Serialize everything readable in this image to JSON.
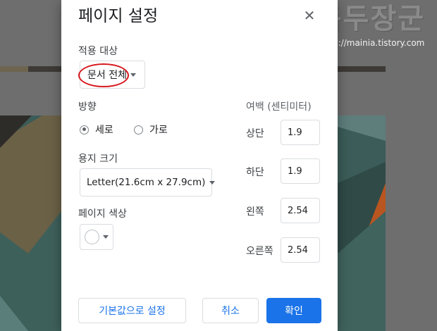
{
  "watermark": {
    "title": "독두장군",
    "url": "http://mainia.tistory.com"
  },
  "dialog": {
    "title": "페이지 설정",
    "apply_to": {
      "label": "적용 대상",
      "value": "문서 전체"
    },
    "orientation": {
      "label": "방향",
      "options": [
        {
          "label": "세로",
          "selected": true
        },
        {
          "label": "가로",
          "selected": false
        }
      ]
    },
    "paper_size": {
      "label": "용지 크기",
      "value": "Letter(21.6cm x 27.9cm)"
    },
    "page_color": {
      "label": "페이지 색상",
      "value": "#ffffff"
    },
    "margins": {
      "label": "여백 (센티미터)",
      "fields": [
        {
          "label": "상단",
          "value": "1.9"
        },
        {
          "label": "하단",
          "value": "1.9"
        },
        {
          "label": "왼쪽",
          "value": "2.54"
        },
        {
          "label": "오른쪽",
          "value": "2.54"
        }
      ]
    },
    "buttons": {
      "set_default": "기본값으로 설정",
      "cancel": "취소",
      "ok": "확인"
    }
  },
  "colors": {
    "accent": "#1a73e8",
    "annotation": "#d8171c",
    "overlay": "#6b6b6b"
  }
}
